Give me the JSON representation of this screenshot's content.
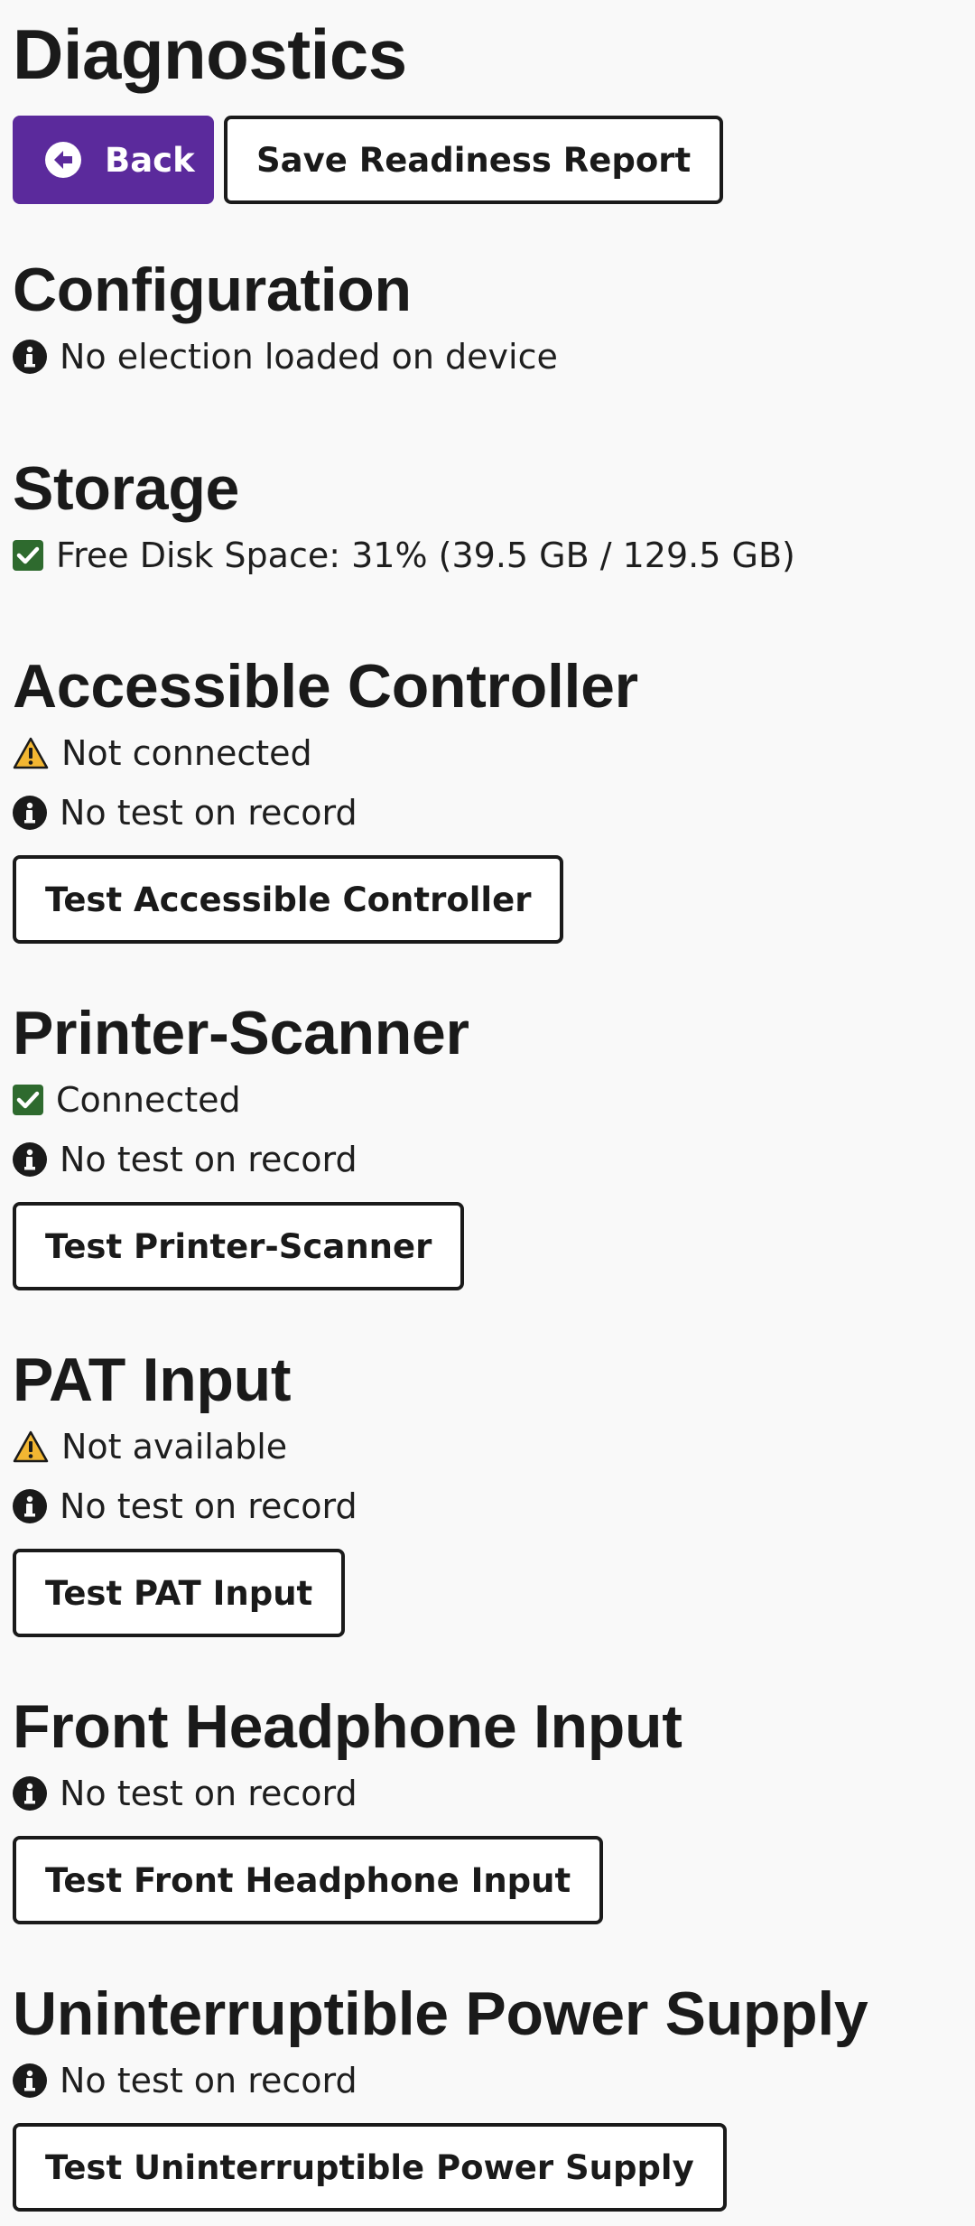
{
  "header": {
    "title": "Diagnostics",
    "back_label": "Back",
    "save_label": "Save Readiness Report"
  },
  "sections": {
    "configuration": {
      "title": "Configuration",
      "status": {
        "icon": "info-icon",
        "text": "No election loaded on device"
      }
    },
    "storage": {
      "title": "Storage",
      "status": {
        "icon": "checkbox-check-icon",
        "text": "Free Disk Space: 31% (39.5 GB / 129.5 GB)"
      }
    },
    "accessible_controller": {
      "title": "Accessible Controller",
      "connection": {
        "icon": "warning-icon",
        "text": "Not connected"
      },
      "test": {
        "icon": "info-icon",
        "text": "No test on record"
      },
      "button": "Test Accessible Controller"
    },
    "printer_scanner": {
      "title": "Printer-Scanner",
      "connection": {
        "icon": "checkbox-check-icon",
        "text": "Connected"
      },
      "test": {
        "icon": "info-icon",
        "text": "No test on record"
      },
      "button": "Test Printer-Scanner"
    },
    "pat_input": {
      "title": "PAT Input",
      "connection": {
        "icon": "warning-icon",
        "text": "Not available"
      },
      "test": {
        "icon": "info-icon",
        "text": "No test on record"
      },
      "button": "Test PAT Input"
    },
    "front_headphone_input": {
      "title": "Front Headphone Input",
      "test": {
        "icon": "info-icon",
        "text": "No test on record"
      },
      "button": "Test Front Headphone Input"
    },
    "ups": {
      "title": "Uninterruptible Power Supply",
      "test": {
        "icon": "info-icon",
        "text": "No test on record"
      },
      "button": "Test Uninterruptible Power Supply"
    }
  },
  "colors": {
    "primary": "#5b2a9c",
    "success": "#2e6a2e",
    "warning": "#f2b632",
    "text": "#1a1a1a",
    "background": "#f9f9f9"
  }
}
